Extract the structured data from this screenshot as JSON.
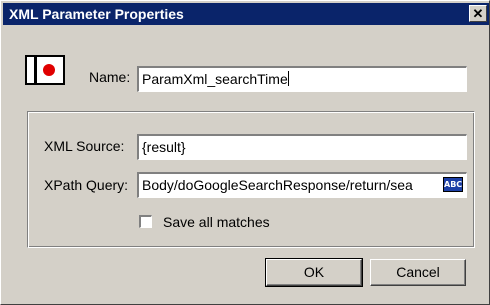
{
  "window": {
    "title": "XML Parameter Properties",
    "close_label": "✕"
  },
  "name_field": {
    "label": "Name:",
    "value": "ParamXml_searchTime"
  },
  "xml_source": {
    "label": "XML Source:",
    "value": "{result}"
  },
  "xpath_query": {
    "label": "XPath Query:",
    "value": "Body/doGoogleSearchResponse/return/sea",
    "button_label": "ABC"
  },
  "save_all": {
    "label": "Save all matches",
    "checked": false
  },
  "buttons": {
    "ok": "OK",
    "cancel": "Cancel"
  },
  "colors": {
    "titlebar": "#0a246a",
    "face": "#d4d0c8",
    "icon_dot": "#e00000",
    "abc_button": "#1c3fa6"
  }
}
